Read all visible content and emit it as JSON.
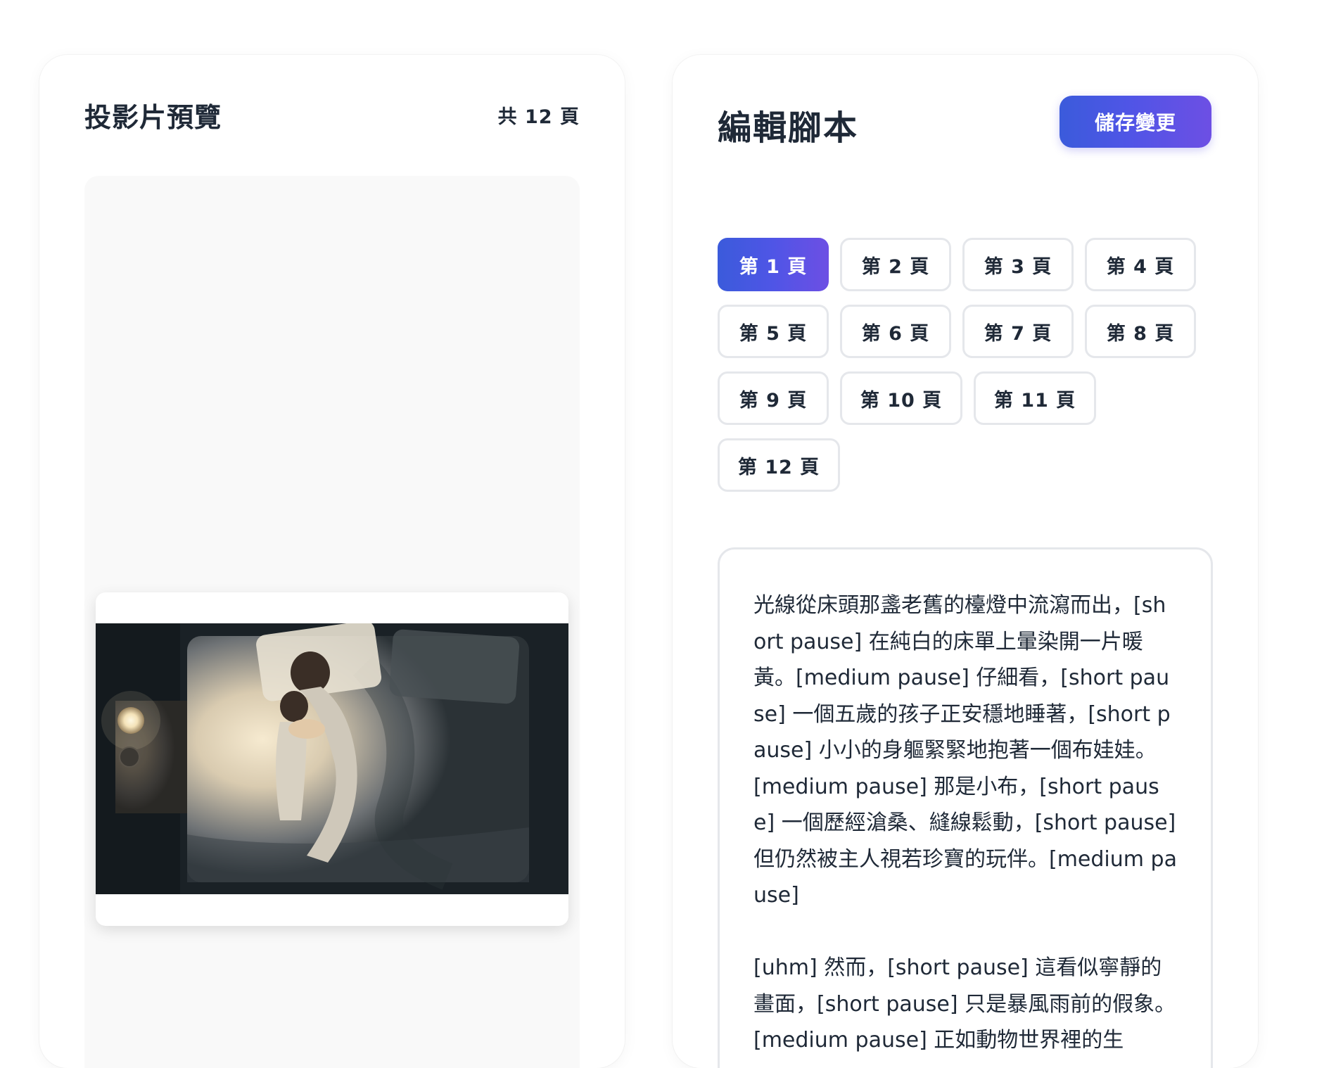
{
  "preview": {
    "title": "投影片預覽",
    "page_count": "共 12 頁"
  },
  "editor": {
    "title": "編輯腳本",
    "save_label": "儲存變更",
    "pages": [
      {
        "label": "第 1 頁",
        "active": true
      },
      {
        "label": "第 2 頁",
        "active": false
      },
      {
        "label": "第 3 頁",
        "active": false
      },
      {
        "label": "第 4 頁",
        "active": false
      },
      {
        "label": "第 5 頁",
        "active": false
      },
      {
        "label": "第 6 頁",
        "active": false
      },
      {
        "label": "第 7 頁",
        "active": false
      },
      {
        "label": "第 8 頁",
        "active": false
      },
      {
        "label": "第 9 頁",
        "active": false
      },
      {
        "label": "第 10 頁",
        "active": false
      },
      {
        "label": "第 11 頁",
        "active": false
      },
      {
        "label": "第 12 頁",
        "active": false
      }
    ],
    "script": "光線從床頭那盞老舊的檯燈中流瀉而出，[short pause] 在純白的床單上暈染開一片暖黃。[medium pause] 仔細看，[short pause] 一個五歲的孩子正安穩地睡著，[short pause] 小小的身軀緊緊地抱著一個布娃娃。[medium pause] 那是小布，[short pause] 一個歷經滄桑、縫線鬆動，[short pause] 但仍然被主人視若珍寶的玩伴。[medium pause]\n\n[uhm] 然而，[short pause] 這看似寧靜的畫面，[short pause] 只是暴風雨前的假象。[medium pause] 正如動物世界裡的生"
  },
  "colors": {
    "accent_start": "#3b5bdb",
    "accent_end": "#6d4fe4",
    "text": "#1f2937",
    "border": "#e5e7eb"
  }
}
